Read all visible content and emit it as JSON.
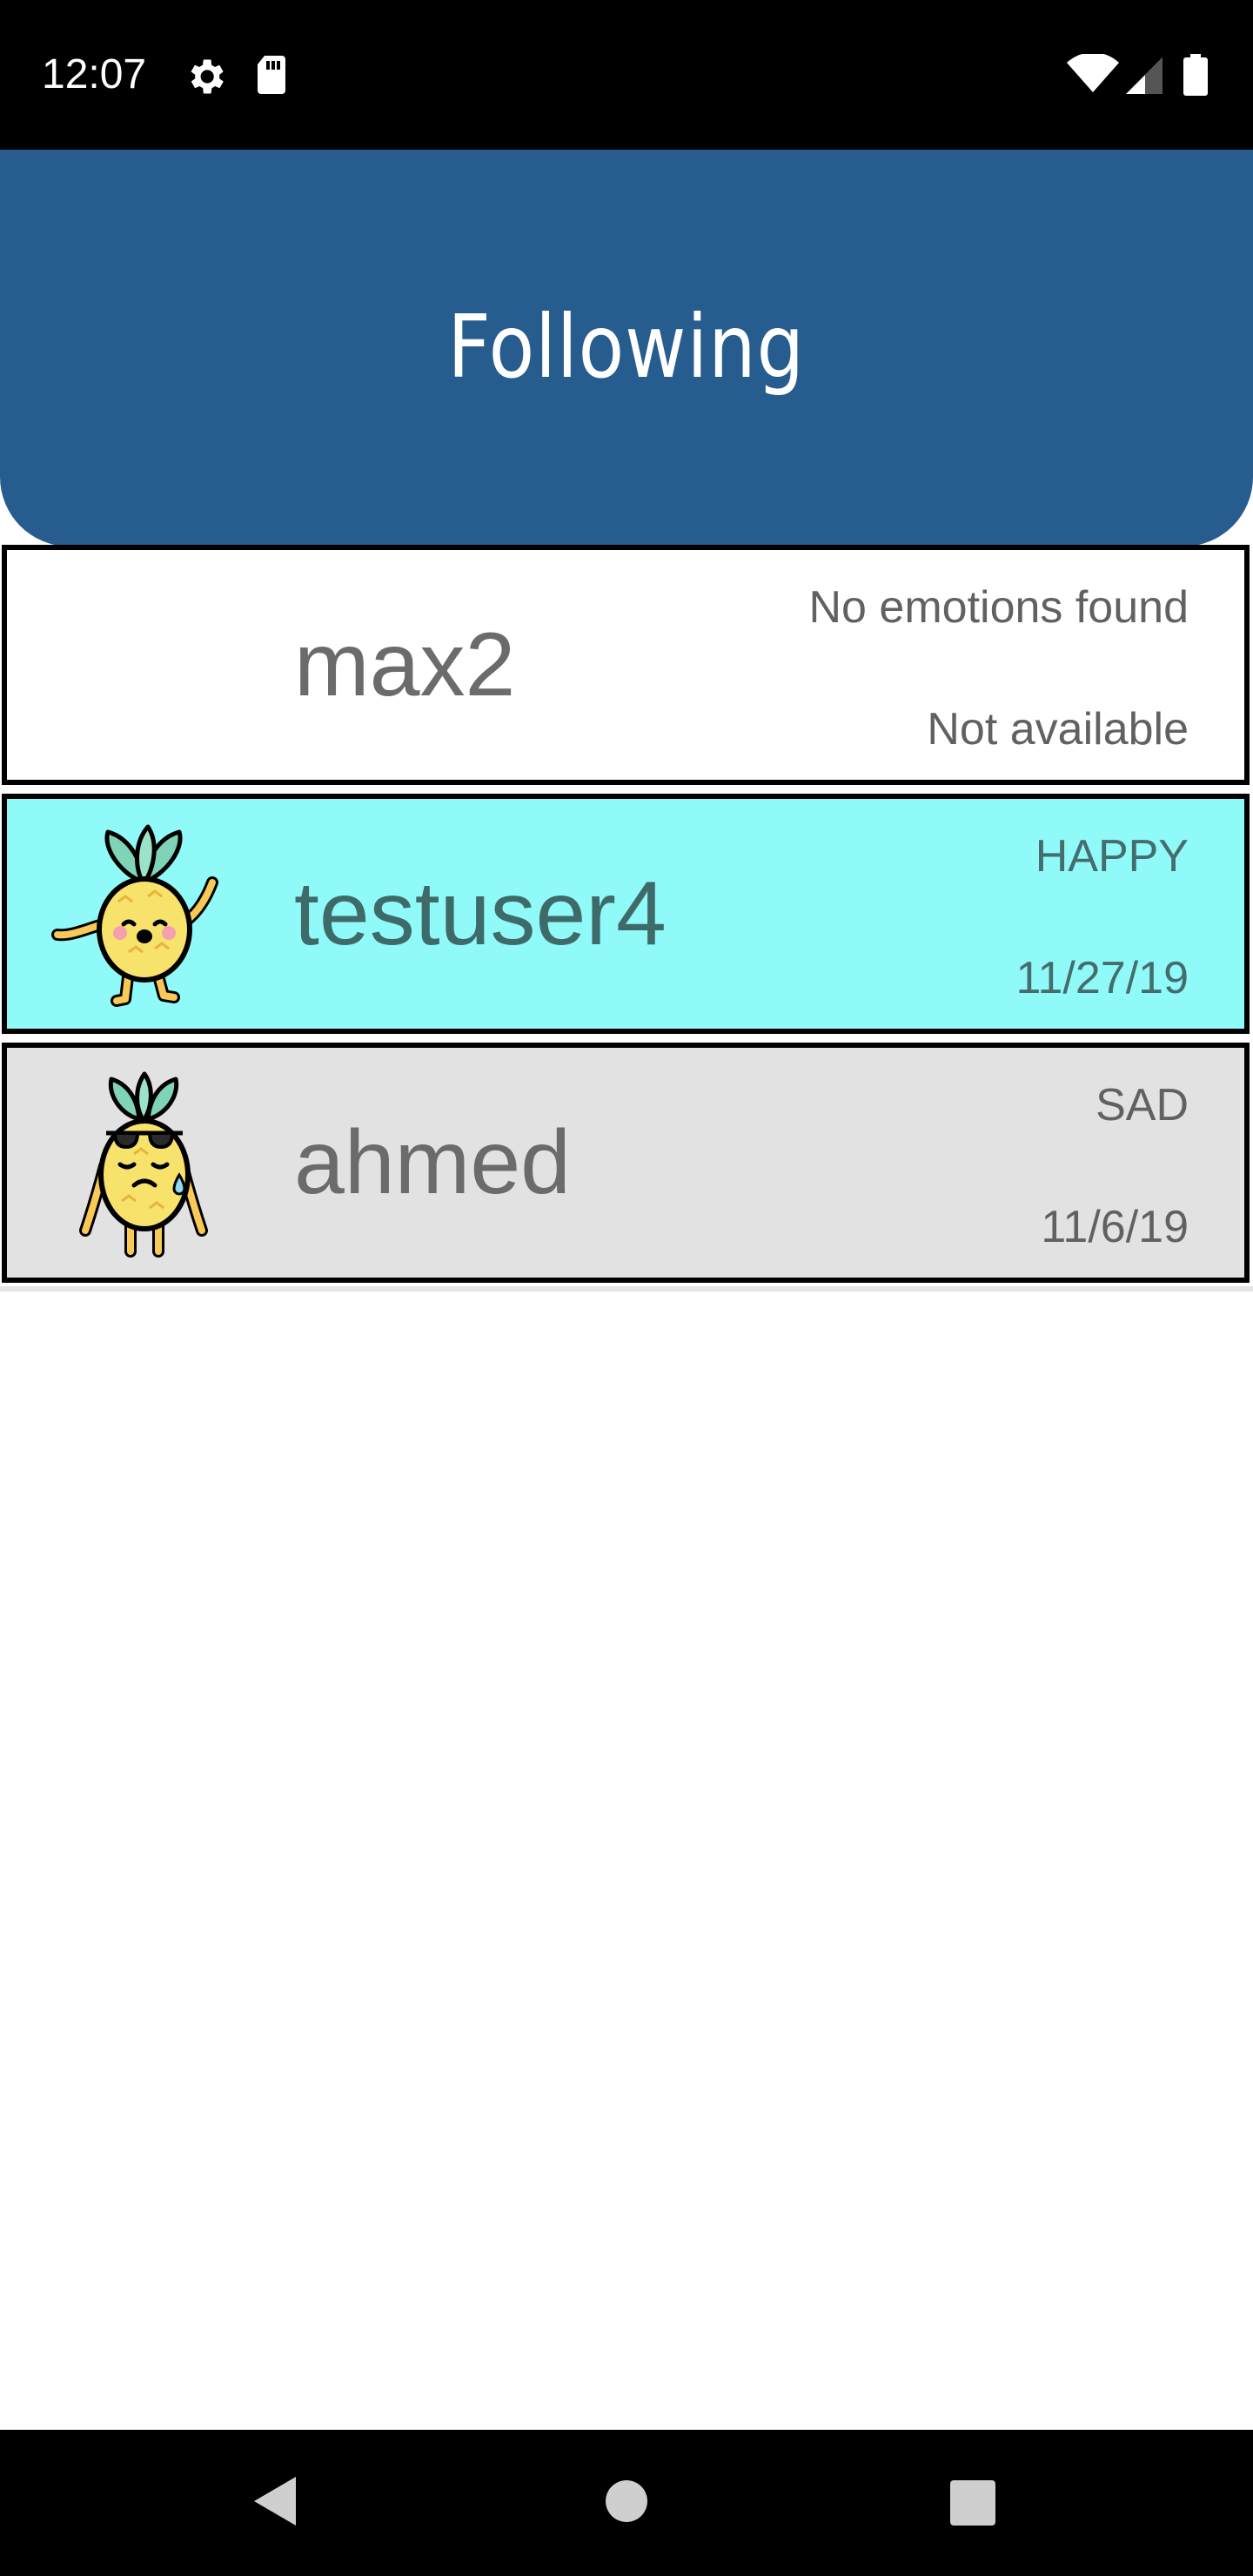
{
  "status_bar": {
    "time": "12:07",
    "left_icons": [
      "gear-icon",
      "sd-card-icon"
    ],
    "right_icons": [
      "wifi-icon",
      "signal-icon",
      "battery-icon"
    ]
  },
  "header": {
    "title": "Following",
    "color": "#265d8e"
  },
  "following": [
    {
      "username": "max2",
      "emotion": "No emotions found",
      "date": "Not available",
      "avatar": "",
      "background": "#ffffff"
    },
    {
      "username": "testuser4",
      "emotion": "HAPPY",
      "date": "11/27/19",
      "avatar": "happy-pineapple-icon",
      "background": "#8ffaf8"
    },
    {
      "username": "ahmed",
      "emotion": "SAD",
      "date": "11/6/19",
      "avatar": "sad-pineapple-icon",
      "background": "#e2e2e2"
    }
  ],
  "nav_bar": {
    "buttons": [
      "back-icon",
      "home-icon",
      "recents-icon"
    ]
  }
}
